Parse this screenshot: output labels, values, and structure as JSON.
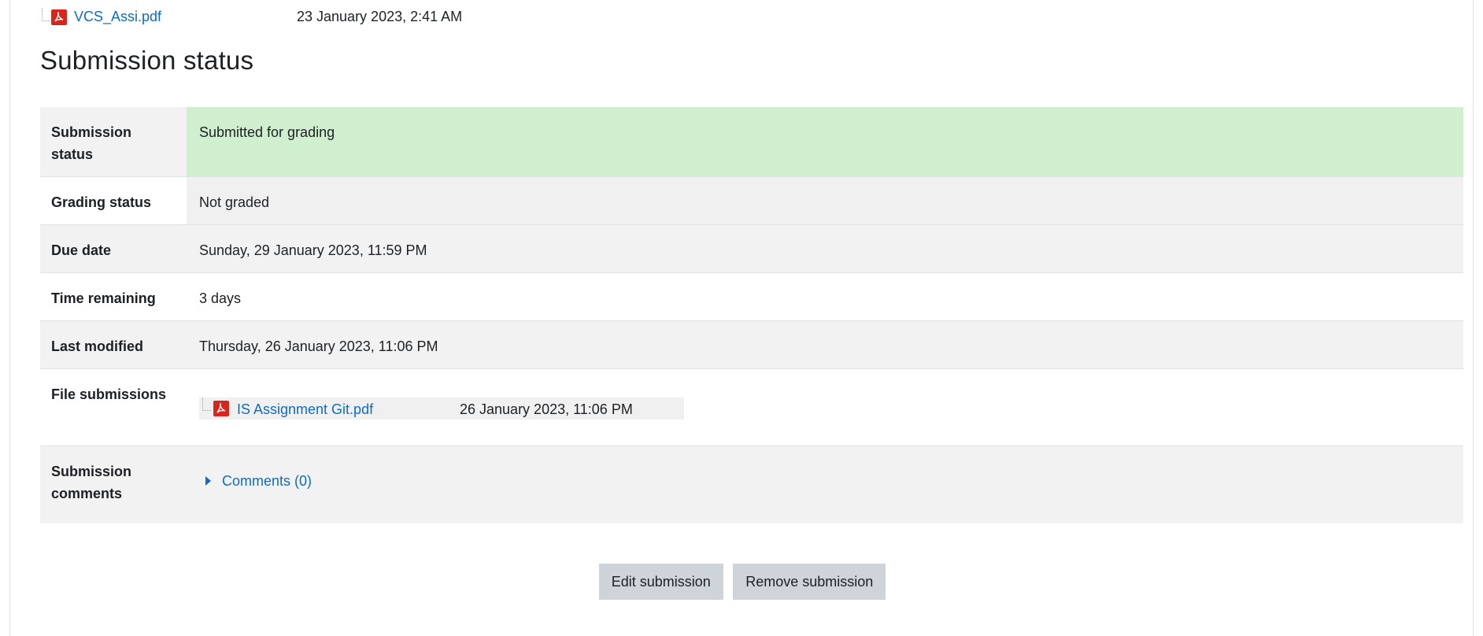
{
  "top_file": {
    "name": "VCS_Assi.pdf",
    "date": "23 January 2023, 2:41 AM"
  },
  "section_title": "Submission status",
  "rows": {
    "submission_status": {
      "label": "Submission status",
      "value": "Submitted for grading"
    },
    "grading_status": {
      "label": "Grading status",
      "value": "Not graded"
    },
    "due_date": {
      "label": "Due date",
      "value": "Sunday, 29 January 2023, 11:59 PM"
    },
    "time_remaining": {
      "label": "Time remaining",
      "value": "3 days"
    },
    "last_modified": {
      "label": "Last modified",
      "value": "Thursday, 26 January 2023, 11:06 PM"
    },
    "file_submissions": {
      "label": "File submissions",
      "file": {
        "name": "IS Assignment Git.pdf",
        "date": "26 January 2023, 11:06 PM"
      }
    },
    "submission_comments": {
      "label": "Submission comments",
      "link": "Comments (0)"
    }
  },
  "buttons": {
    "edit": "Edit submission",
    "remove": "Remove submission"
  },
  "colors": {
    "link": "#0f6cbf",
    "submitted_bg": "#cfefcf",
    "button_bg": "#ced4da",
    "pdf_red": "#d9261c"
  },
  "icons": {
    "file": "pdf-icon",
    "expand": "caret-right-icon"
  }
}
